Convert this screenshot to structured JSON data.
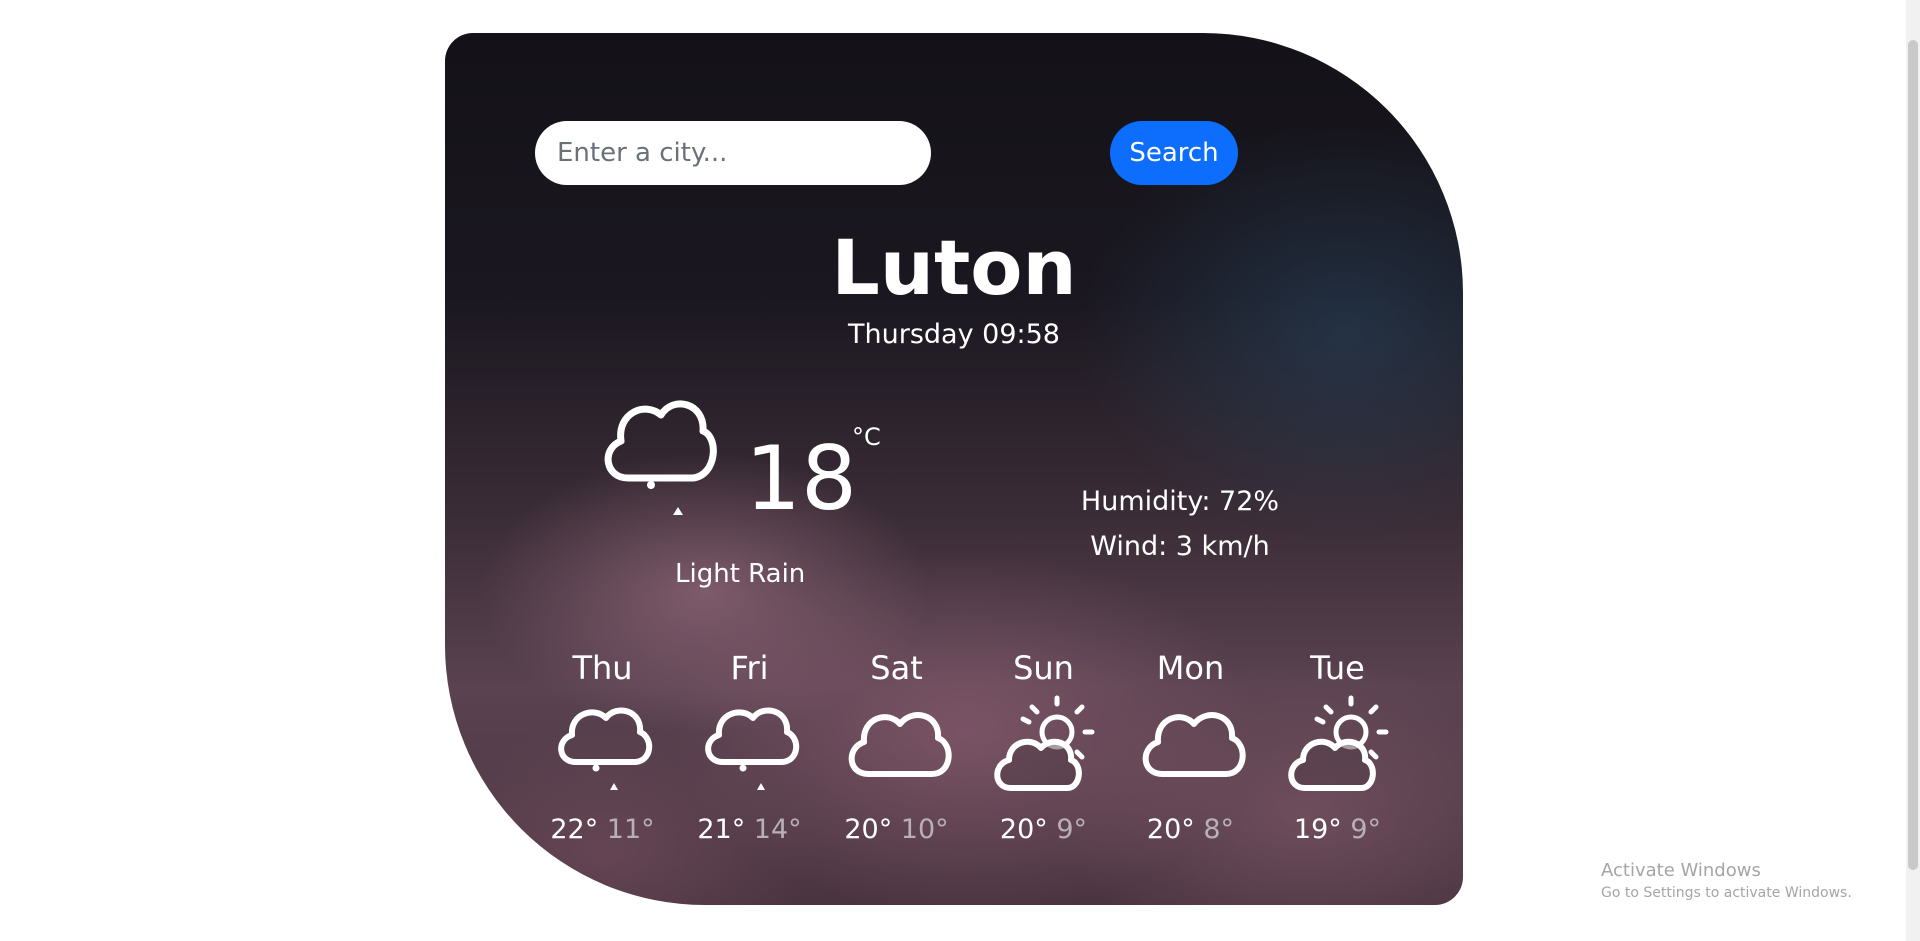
{
  "search": {
    "placeholder": "Enter a city...",
    "button_label": "Search"
  },
  "current": {
    "city": "Luton",
    "datetime": "Thursday 09:58",
    "icon": "light-rain-icon",
    "temperature": "18",
    "unit": "°C",
    "description": "Light Rain",
    "humidity": "Humidity: 72%",
    "wind": "Wind: 3 km/h"
  },
  "forecast": [
    {
      "day": "Thu",
      "high": "22°",
      "low": "11°",
      "icon": "rain-icon"
    },
    {
      "day": "Fri",
      "high": "21°",
      "low": "14°",
      "icon": "rain-icon"
    },
    {
      "day": "Sat",
      "high": "20°",
      "low": "10°",
      "icon": "cloud-icon"
    },
    {
      "day": "Sun",
      "high": "20°",
      "low": "9°",
      "icon": "partly-sunny-icon"
    },
    {
      "day": "Mon",
      "high": "20°",
      "low": "8°",
      "icon": "cloud-icon"
    },
    {
      "day": "Tue",
      "high": "19°",
      "low": "9°",
      "icon": "partly-sunny-icon"
    }
  ],
  "watermark": {
    "line1": "Activate Windows",
    "line2": "Go to Settings to activate Windows."
  },
  "colors": {
    "accent": "#0d6efd",
    "text": "#ffffff",
    "low_temp": "#b8b0b5"
  }
}
